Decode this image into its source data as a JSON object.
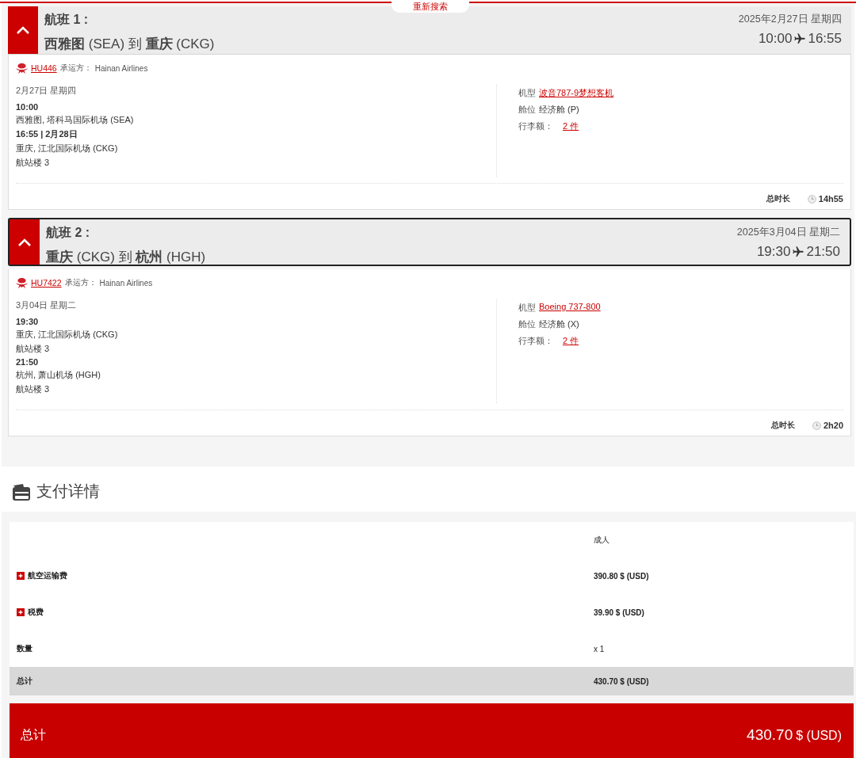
{
  "top_tab": {
    "label": "重新搜索"
  },
  "flights": [
    {
      "title": "航班 1 :",
      "route": "**西雅图** (SEA) 到 **重庆** (CKG)",
      "date": "2025年2月27日 星期四",
      "depart": "10:00",
      "arrive": "16:55",
      "expanded": true,
      "focused": false,
      "flight_no": "HU446",
      "carrier_label": "承运方：",
      "carrier": "Hainan Airlines",
      "day": "2月27日 星期四",
      "segments": [
        {
          "time": "10:00",
          "airport": "西雅图, 塔科马国际机场 (SEA)"
        },
        {
          "time": "16:55 | 2月28日",
          "airport": "重庆, 江北国际机场 (CKG)",
          "terminal": "航站楼 3"
        }
      ],
      "aircraft_label": "机型",
      "aircraft": "波音787-9梦想客机",
      "cabin_label": "舱位",
      "cabin": "经济舱 (P)",
      "baggage_label": "行李额：",
      "baggage": "2 件",
      "duration_label": "总时长",
      "duration": "14h55"
    },
    {
      "title": "航班 2 :",
      "route": "**重庆** (CKG) 到 **杭州** (HGH)",
      "date": "2025年3月04日 星期二",
      "depart": "19:30",
      "arrive": "21:50",
      "expanded": true,
      "focused": true,
      "flight_no": "HU7422",
      "carrier_label": "承运方：",
      "carrier": "Hainan Airlines",
      "day": "3月04日 星期二",
      "segments": [
        {
          "time": "19:30",
          "airport": "重庆, 江北国际机场 (CKG)",
          "terminal": "航站楼 3"
        },
        {
          "time": "21:50",
          "airport": "杭州, 萧山机场 (HGH)",
          "terminal": "航站楼 3"
        }
      ],
      "aircraft_label": "机型",
      "aircraft": "Boeing 737-800",
      "cabin_label": "舱位",
      "cabin": "经济舱 (X)",
      "baggage_label": "行李额：",
      "baggage": "2 件",
      "duration_label": "总时长",
      "duration": "2h20"
    }
  ],
  "payment": {
    "title": "支付详情",
    "header": "成人",
    "rows": [
      {
        "kind": "expandable",
        "label": "航空运输费",
        "value": "390.80 $ (USD)"
      },
      {
        "kind": "expandable",
        "label": "税费",
        "value": "39.90 $ (USD)"
      },
      {
        "kind": "plain",
        "label": "数量",
        "value": "x 1"
      },
      {
        "kind": "total",
        "label": "总计",
        "value": "430.70 $ (USD)"
      }
    ],
    "grand_total": {
      "label": "总计",
      "amount": "430.70",
      "currency": "$ (USD)"
    }
  }
}
